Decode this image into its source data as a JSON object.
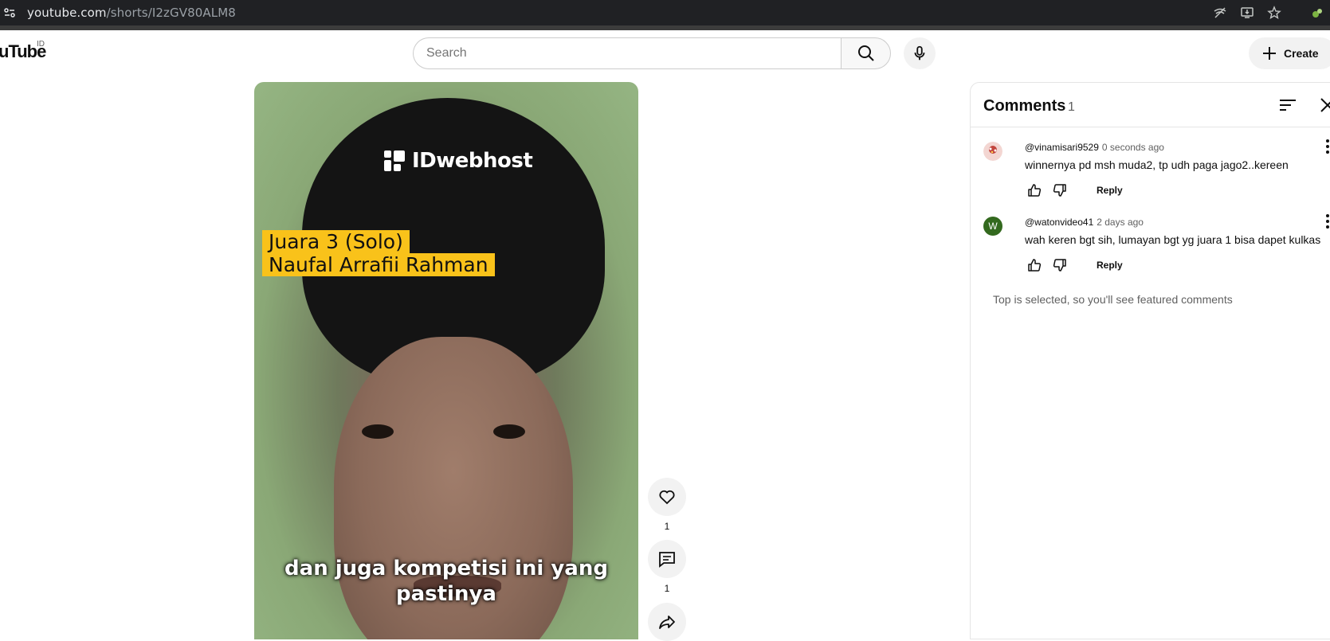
{
  "browser": {
    "url_host": "youtube.com",
    "url_path": "/shorts/I2zGV80ALM8"
  },
  "masthead": {
    "logo_text": "uTube",
    "logo_region": "ID",
    "search_placeholder": "Search",
    "create_label": "Create"
  },
  "video": {
    "brand": "IDwebhost",
    "title_line1": "Juara 3 (Solo)",
    "title_line2": "Naufal Arrafii Rahman",
    "caption_line1": "dan juga kompetisi ini yang",
    "caption_line2": "pastinya"
  },
  "actions": {
    "like_count": "1",
    "comment_count": "1"
  },
  "comments": {
    "title": "Comments",
    "count": "1",
    "items": [
      {
        "author": "@vinamisari9529",
        "time": "0 seconds ago",
        "text": "winnernya pd msh muda2, tp udh paga jago2..kereen",
        "reply_label": "Reply"
      },
      {
        "author": "@watonvideo41",
        "time": "2 days ago",
        "text": "wah keren bgt sih, lumayan bgt yg juara 1 bisa dapet kulkas",
        "reply_label": "Reply",
        "avatar_letter": "W"
      }
    ],
    "featured_note": "Top is selected, so you'll see featured comments"
  },
  "colors": {
    "brand_yellow": "#f9c21a",
    "avatar_green": "#33691e"
  }
}
